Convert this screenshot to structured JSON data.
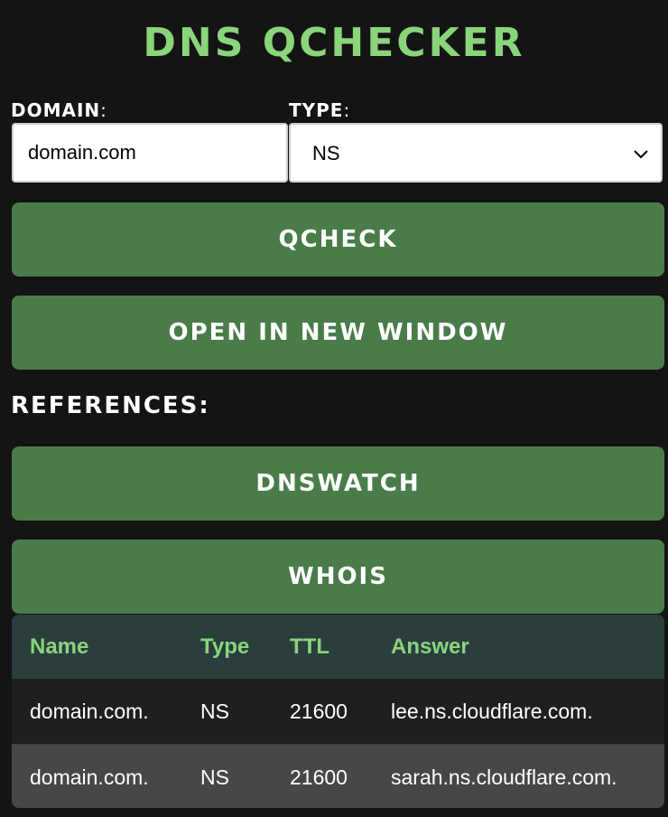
{
  "app": {
    "title": "DNS QCHECKER"
  },
  "form": {
    "domain_label": "DOMAIN",
    "type_label": "TYPE",
    "label_suffix": ":",
    "domain_value": "domain.com",
    "type_value": "NS"
  },
  "buttons": {
    "qcheck": "QCHECK",
    "open_new_window": "OPEN IN NEW WINDOW"
  },
  "references": {
    "label": "REFERENCES:",
    "dnswatch": "DNSWATCH",
    "whois": "WHOIS"
  },
  "results": {
    "headers": [
      "Name",
      "Type",
      "TTL",
      "Answer"
    ],
    "rows": [
      [
        "domain.com.",
        "NS",
        "21600",
        "lee.ns.cloudflare.com."
      ],
      [
        "domain.com.",
        "NS",
        "21600",
        "sarah.ns.cloudflare.com."
      ]
    ]
  },
  "colors": {
    "accent": "#8ad47c",
    "button": "#4a7c4a",
    "background": "#141414",
    "table_header": "#2a3e3e"
  },
  "icons": {
    "type_dropdown": "chevron-down-icon"
  }
}
